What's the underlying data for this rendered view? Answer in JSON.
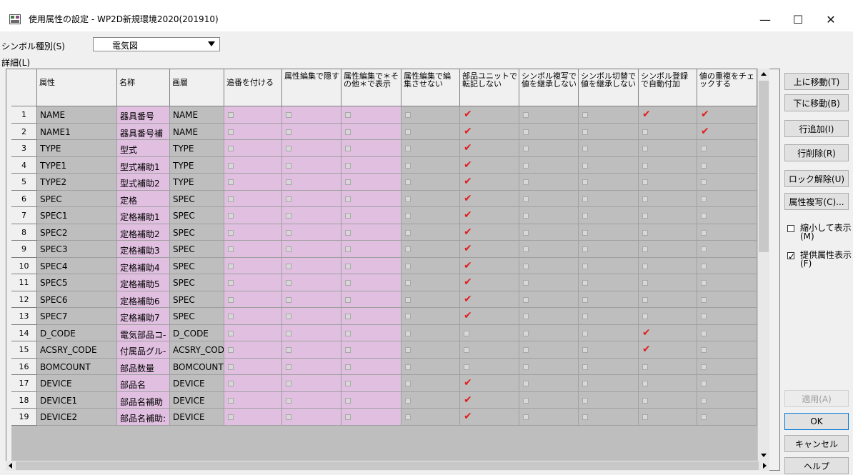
{
  "window": {
    "title": "使用属性の設定 - WP2D新規環境2020(201910)",
    "min": "—",
    "max": "☐",
    "close": "✕"
  },
  "symbol_type": {
    "label": "シンボル種別(S)",
    "value": "電気図"
  },
  "detail_label": "詳細(L)",
  "columns": [
    "属性",
    "名称",
    "画層",
    "追番を付ける",
    "属性編集で隠す",
    "属性編集で＊その他＊で表示",
    "属性編集で編集させない",
    "部品ユニットで転記しない",
    "シンボル複写で値を継承しない",
    "シンボル切替で値を継承しない",
    "シンボル登録で自動付加",
    "値の重複をチェックする"
  ],
  "rows": [
    {
      "num": "1",
      "attr": "NAME",
      "name": "器具番号",
      "layer": "NAME",
      "unit": true,
      "reg": true,
      "dup": true
    },
    {
      "num": "2",
      "attr": "NAME1",
      "name": "器具番号補",
      "layer": "NAME",
      "unit": true,
      "reg": false,
      "dup": true
    },
    {
      "num": "3",
      "attr": "TYPE",
      "name": "型式",
      "layer": "TYPE",
      "unit": true,
      "reg": false,
      "dup": false
    },
    {
      "num": "4",
      "attr": "TYPE1",
      "name": "型式補助1",
      "layer": "TYPE",
      "unit": true,
      "reg": false,
      "dup": false
    },
    {
      "num": "5",
      "attr": "TYPE2",
      "name": "型式補助2",
      "layer": "TYPE",
      "unit": true,
      "reg": false,
      "dup": false
    },
    {
      "num": "6",
      "attr": "SPEC",
      "name": "定格",
      "layer": "SPEC",
      "unit": true,
      "reg": false,
      "dup": false
    },
    {
      "num": "7",
      "attr": "SPEC1",
      "name": "定格補助1",
      "layer": "SPEC",
      "unit": true,
      "reg": false,
      "dup": false
    },
    {
      "num": "8",
      "attr": "SPEC2",
      "name": "定格補助2",
      "layer": "SPEC",
      "unit": true,
      "reg": false,
      "dup": false
    },
    {
      "num": "9",
      "attr": "SPEC3",
      "name": "定格補助3",
      "layer": "SPEC",
      "unit": true,
      "reg": false,
      "dup": false
    },
    {
      "num": "10",
      "attr": "SPEC4",
      "name": "定格補助4",
      "layer": "SPEC",
      "unit": true,
      "reg": false,
      "dup": false
    },
    {
      "num": "11",
      "attr": "SPEC5",
      "name": "定格補助5",
      "layer": "SPEC",
      "unit": true,
      "reg": false,
      "dup": false
    },
    {
      "num": "12",
      "attr": "SPEC6",
      "name": "定格補助6",
      "layer": "SPEC",
      "unit": true,
      "reg": false,
      "dup": false
    },
    {
      "num": "13",
      "attr": "SPEC7",
      "name": "定格補助7",
      "layer": "SPEC",
      "unit": true,
      "reg": false,
      "dup": false
    },
    {
      "num": "14",
      "attr": "D_CODE",
      "name": "電気部品コ-",
      "layer": "D_CODE",
      "unit": false,
      "reg": true,
      "dup": false
    },
    {
      "num": "15",
      "attr": "ACSRY_CODE",
      "name": "付属品グル-",
      "layer": "ACSRY_COD",
      "unit": false,
      "reg": true,
      "dup": false
    },
    {
      "num": "16",
      "attr": "BOMCOUNT",
      "name": "部品数量",
      "layer": "BOMCOUNT",
      "unit": false,
      "reg": false,
      "dup": false
    },
    {
      "num": "17",
      "attr": "DEVICE",
      "name": "部品名",
      "layer": "DEVICE",
      "unit": true,
      "reg": false,
      "dup": false
    },
    {
      "num": "18",
      "attr": "DEVICE1",
      "name": "部品名補助",
      "layer": "DEVICE",
      "unit": true,
      "reg": false,
      "dup": false
    },
    {
      "num": "19",
      "attr": "DEVICE2",
      "name": "部品名補助:",
      "layer": "DEVICE",
      "unit": true,
      "reg": false,
      "dup": false
    }
  ],
  "buttons": {
    "move_up": "上に移動(T)",
    "move_down": "下に移動(B)",
    "add_row": "行追加(I)",
    "delete_row": "行削除(R)",
    "unlock": "ロック解除(U)",
    "copy_attr": "属性複写(C)...",
    "apply": "適用(A)",
    "ok": "OK",
    "cancel": "キャンセル",
    "help": "ヘルプ"
  },
  "options": {
    "shrink": {
      "label": "縮小して表示(M)",
      "checked": false
    },
    "provided": {
      "label": "提供属性表示(F)",
      "checked": true
    }
  },
  "colors": {
    "pink": "#e0bfe0",
    "gray": "#bebebe",
    "check_red": "#e02020"
  }
}
